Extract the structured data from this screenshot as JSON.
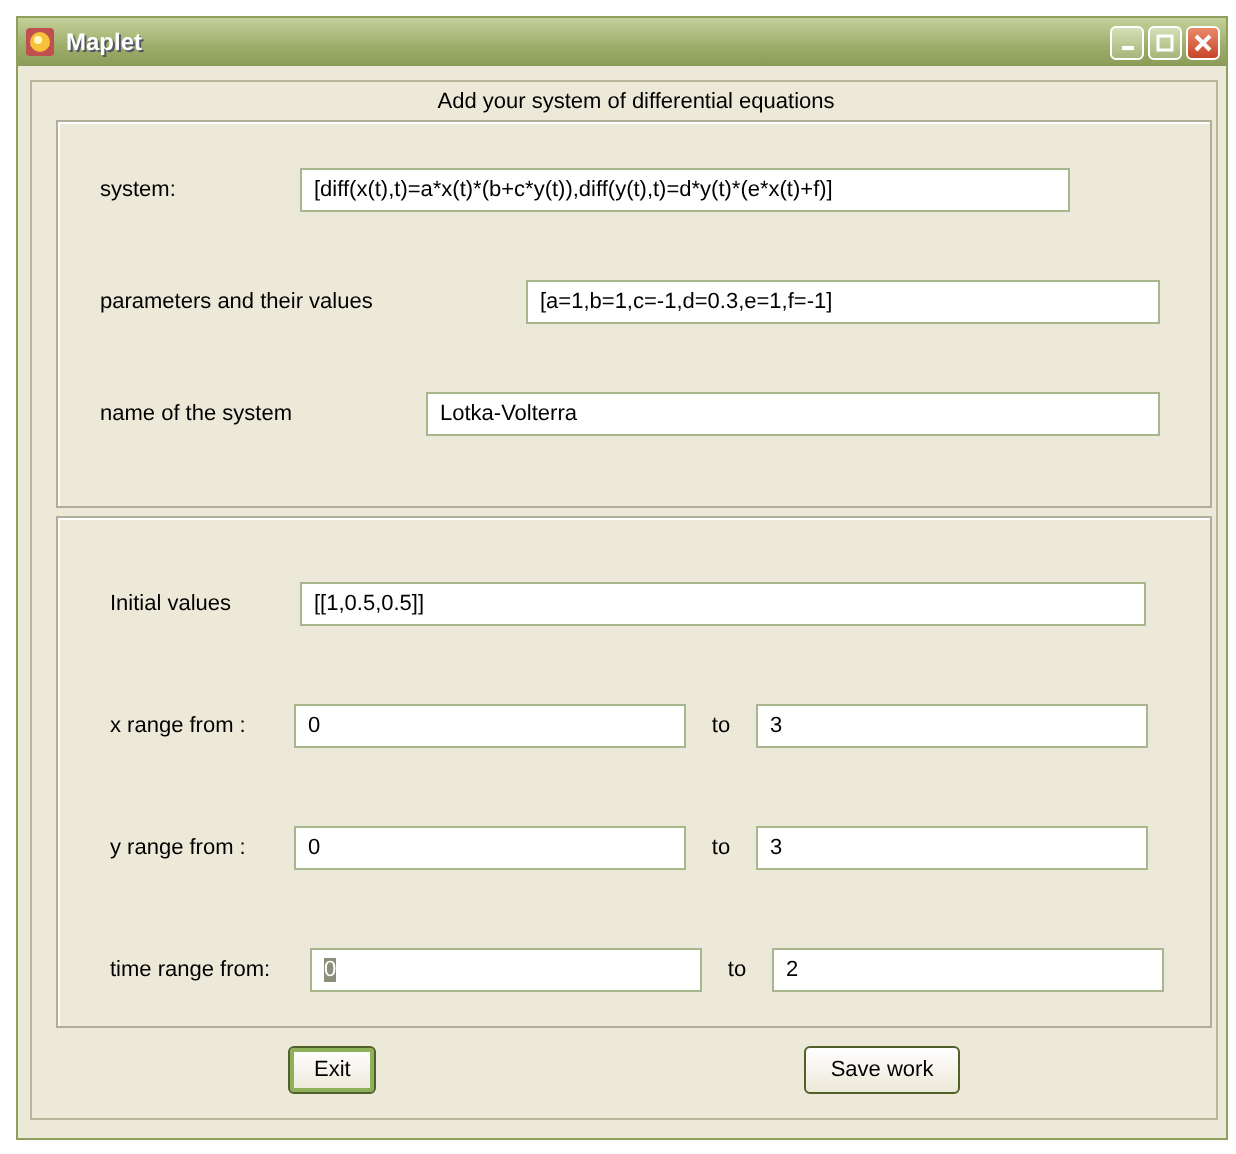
{
  "window": {
    "title": "Maplet"
  },
  "heading": "Add your system of differential equations",
  "system_panel": {
    "rows": [
      {
        "label": "system:",
        "value": "[diff(x(t),t)=a*x(t)*(b+c*y(t)),diff(y(t),t)=d*y(t)*(e*x(t)+f)]"
      },
      {
        "label": "parameters and their values",
        "value": "[a=1,b=1,c=-1,d=0.3,e=1,f=-1]"
      },
      {
        "label": "name of the system",
        "value": "Lotka-Volterra"
      }
    ]
  },
  "range_panel": {
    "initial": {
      "label": "Initial values",
      "value": "[[1,0.5,0.5]]"
    },
    "ranges": [
      {
        "label": "x range from :",
        "from": "0",
        "from_highlighted": false,
        "to_label": "to",
        "to": "3"
      },
      {
        "label": "y range from :",
        "from": "0",
        "from_highlighted": false,
        "to_label": "to",
        "to": "3"
      },
      {
        "label": "time range from:",
        "from": "0",
        "from_highlighted": true,
        "to_label": "to",
        "to": "2"
      }
    ]
  },
  "buttons": [
    {
      "label": "Exit",
      "focused": true
    },
    {
      "label": "Save work",
      "focused": false
    }
  ]
}
